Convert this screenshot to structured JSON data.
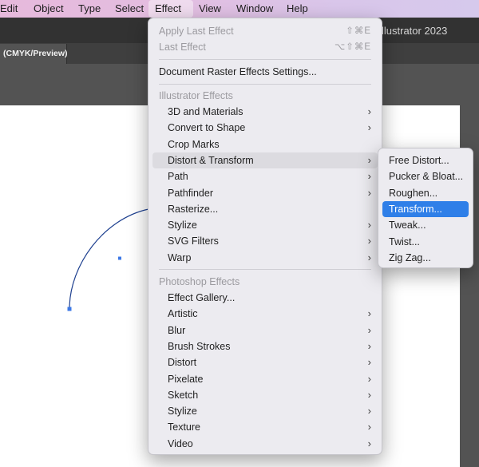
{
  "menubar": {
    "items": [
      "Edit",
      "Object",
      "Type",
      "Select",
      "Effect",
      "View",
      "Window",
      "Help"
    ],
    "active": "Effect"
  },
  "app": {
    "title": "llustrator 2023",
    "doc_tab": "(CMYK/Preview)"
  },
  "effect_menu": {
    "apply_last": {
      "label": "Apply Last Effect",
      "shortcut": "⇧⌘E"
    },
    "last": {
      "label": "Last Effect",
      "shortcut": "⌥⇧⌘E"
    },
    "raster_settings": "Document Raster Effects Settings...",
    "illustrator_header": "Illustrator Effects",
    "illustrator_items": [
      {
        "label": "3D and Materials",
        "submenu": true
      },
      {
        "label": "Convert to Shape",
        "submenu": true
      },
      {
        "label": "Crop Marks",
        "submenu": false
      },
      {
        "label": "Distort & Transform",
        "submenu": true
      },
      {
        "label": "Path",
        "submenu": true
      },
      {
        "label": "Pathfinder",
        "submenu": true
      },
      {
        "label": "Rasterize...",
        "submenu": false
      },
      {
        "label": "Stylize",
        "submenu": true
      },
      {
        "label": "SVG Filters",
        "submenu": true
      },
      {
        "label": "Warp",
        "submenu": true
      }
    ],
    "photoshop_header": "Photoshop Effects",
    "photoshop_items": [
      {
        "label": "Effect Gallery...",
        "submenu": false
      },
      {
        "label": "Artistic",
        "submenu": true
      },
      {
        "label": "Blur",
        "submenu": true
      },
      {
        "label": "Brush Strokes",
        "submenu": true
      },
      {
        "label": "Distort",
        "submenu": true
      },
      {
        "label": "Pixelate",
        "submenu": true
      },
      {
        "label": "Sketch",
        "submenu": true
      },
      {
        "label": "Stylize",
        "submenu": true
      },
      {
        "label": "Texture",
        "submenu": true
      },
      {
        "label": "Video",
        "submenu": true
      }
    ],
    "chevron": "›"
  },
  "distort_submenu": {
    "items": [
      "Free Distort...",
      "Pucker & Bloat...",
      "Roughen...",
      "Transform...",
      "Tweak...",
      "Twist...",
      "Zig Zag..."
    ],
    "selected": "Transform..."
  },
  "colors": {
    "selection_blue": "#2f7fe8",
    "path_stroke": "#1d3f8f",
    "anchor_blue": "#3c78e6"
  }
}
